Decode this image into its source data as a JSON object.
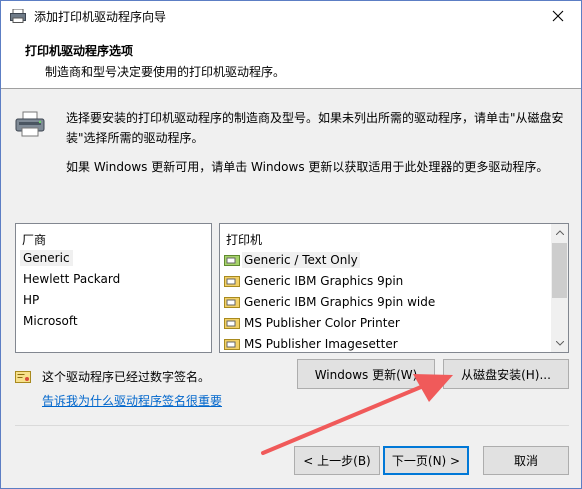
{
  "window": {
    "title": "添加打印机驱动程序向导"
  },
  "header": {
    "title": "打印机驱动程序选项",
    "subtitle": "制造商和型号决定要使用的打印机驱动程序。"
  },
  "instructions": {
    "line1": "选择要安装的打印机驱动程序的制造商及型号。如果未列出所需的驱动程序，请单击\"从磁盘安装\"选择所需的驱动程序。",
    "line2": "如果 Windows 更新可用，请单击 Windows 更新以获取适用于此处理器的更多驱动程序。"
  },
  "manufacturers": {
    "header": "厂商",
    "items": [
      "Generic",
      "Hewlett Packard",
      "HP",
      "Microsoft"
    ],
    "selected_index": 0
  },
  "printers": {
    "header": "打印机",
    "items": [
      "Generic / Text Only",
      "Generic IBM Graphics 9pin",
      "Generic IBM Graphics 9pin wide",
      "MS Publisher Color Printer",
      "MS Publisher Imagesetter"
    ],
    "selected_index": 0
  },
  "signature": {
    "text": "这个驱动程序已经过数字签名。",
    "link": "告诉我为什么驱动程序签名很重要"
  },
  "buttons": {
    "windows_update": "Windows 更新(W)",
    "have_disk": "从磁盘安装(H)...",
    "back": "< 上一步(B)",
    "next": "下一页(N) >",
    "cancel": "取消"
  },
  "colors": {
    "accent": "#0078d7",
    "link": "#0066cc",
    "arrow": "#f05a5a"
  },
  "icons": {
    "title": "printer-wizard-icon",
    "close": "close-icon",
    "printer": "printer-icon",
    "driver": "printer-driver-icon",
    "certificate": "certificate-icon"
  }
}
